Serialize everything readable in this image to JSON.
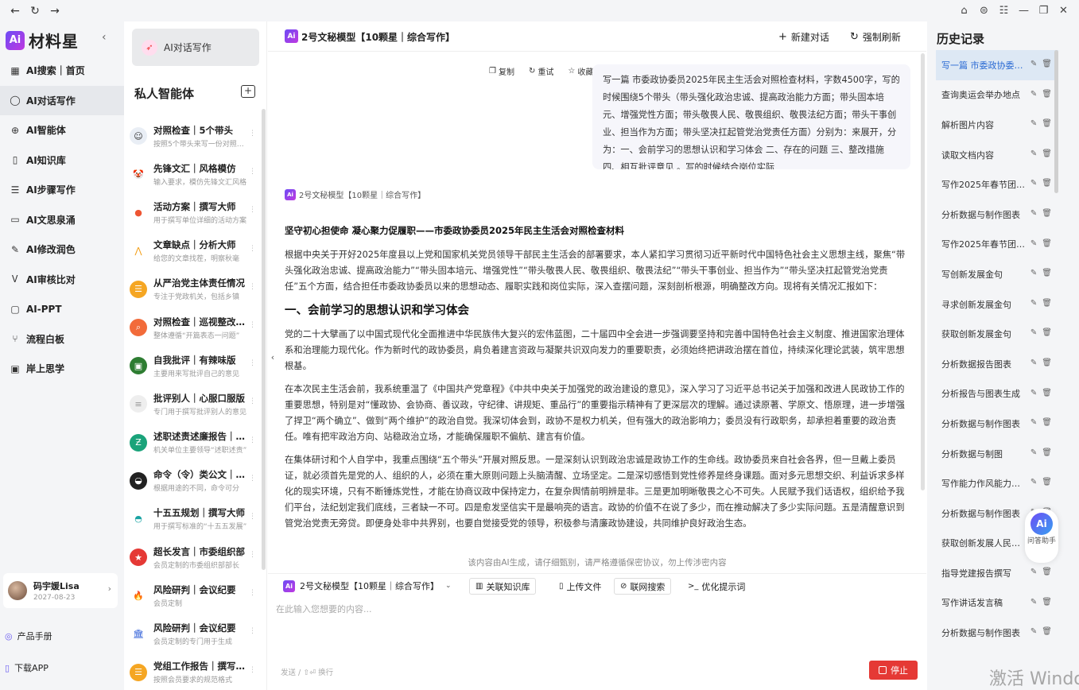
{
  "brand": {
    "logo_mark": "Ai",
    "name": "材料星"
  },
  "nav": {
    "items": [
      {
        "label": "AI搜索｜首页",
        "icon": "grid-icon",
        "glyph": "▦"
      },
      {
        "label": "AI对话写作",
        "icon": "chat-bubble-icon",
        "glyph": "◯",
        "active": true
      },
      {
        "label": "AI智能体",
        "icon": "agent-icon",
        "glyph": "⊕"
      },
      {
        "label": "AI知识库",
        "icon": "book-icon",
        "glyph": "▯"
      },
      {
        "label": "AI步骤写作",
        "icon": "steps-icon",
        "glyph": "☰"
      },
      {
        "label": "AI文思泉涌",
        "icon": "keyboard-icon",
        "glyph": "▭"
      },
      {
        "label": "AI修改润色",
        "icon": "pen-icon",
        "glyph": "✎"
      },
      {
        "label": "AI审核比对",
        "icon": "check-icon",
        "glyph": "Ꮩ"
      },
      {
        "label": "AI-PPT",
        "icon": "ppt-icon",
        "glyph": "▢"
      },
      {
        "label": "流程白板",
        "icon": "flow-icon",
        "glyph": "⑂"
      },
      {
        "label": "岸上思学",
        "icon": "monitor-icon",
        "glyph": "▣"
      }
    ]
  },
  "user": {
    "name": "码宇媛Lisa",
    "date": "2027-08-23"
  },
  "bottom_links": {
    "manual": "产品手册",
    "download": "下载APP"
  },
  "agents_panel": {
    "primary_button": "AI对话写作",
    "title": "私人智能体",
    "items": [
      {
        "name": "对照检查｜5个带头",
        "desc": "按照5个带头来写一份对照检查",
        "color": "#e9eef5",
        "glyph": "☺",
        "fg": "#333"
      },
      {
        "name": "先锋文汇｜风格模仿",
        "desc": "输入要求，模仿先锋文汇风格",
        "color": "#ffffff",
        "glyph": "🤡",
        "fg": "#e33"
      },
      {
        "name": "活动方案｜撰写大师",
        "desc": "用于撰写单位详细的活动方案",
        "color": "#ffffff",
        "glyph": "●",
        "fg": "#e53"
      },
      {
        "name": "文章缺点｜分析大师",
        "desc": "给您的文章找茬，明察秋毫",
        "color": "#ffffff",
        "glyph": "⋀",
        "fg": "#f39c12"
      },
      {
        "name": "从严治党主体责任情况",
        "desc": "专注于党政机关，包括乡镇",
        "color": "#f5a623",
        "glyph": "☰",
        "fg": "#fff"
      },
      {
        "name": "对照检查｜巡视整改专题",
        "desc": "整体遵循“开篇表态一问题”",
        "color": "#f26b3a",
        "glyph": "⌕",
        "fg": "#fff"
      },
      {
        "name": "自我批评｜有辣味版",
        "desc": "主要用来写批评自己的意见",
        "color": "#2e7d32",
        "glyph": "▣",
        "fg": "#fff"
      },
      {
        "name": "批评别人｜心服口服版",
        "desc": "专门用于撰写批评别人的意见",
        "color": "#eeeeee",
        "glyph": "≡",
        "fg": "#999"
      },
      {
        "name": "述职述责述廉报告｜常规",
        "desc": "机关单位主要领导“述职述责”",
        "color": "#1aa37a",
        "glyph": "Ƶ",
        "fg": "#fff"
      },
      {
        "name": "命令（令）类公文｜专业",
        "desc": "根据用途的不同，命令可分",
        "color": "#222222",
        "glyph": "◒",
        "fg": "#fff"
      },
      {
        "name": "十五五规划｜撰写大师",
        "desc": "用于撰写标准的“十五五发展”",
        "color": "#ffffff",
        "glyph": "◓",
        "fg": "#1aa3a3"
      },
      {
        "name": "超长发言｜市委组织部",
        "desc": "会员定制的市委组织部部长",
        "color": "#e53935",
        "glyph": "★",
        "fg": "#fff"
      },
      {
        "name": "风险研判｜会议纪要",
        "desc": "会员定制",
        "color": "#ffffff",
        "glyph": "🔥",
        "fg": "#f39c12"
      },
      {
        "name": "风险研判｜会议纪要",
        "desc": "会员定制的专门用于生成",
        "color": "#ffffff",
        "glyph": "🏛",
        "fg": "#2a5bd7"
      },
      {
        "name": "党组工作报告｜撰写大师",
        "desc": "按照会员要求的规范格式",
        "color": "#f5a623",
        "glyph": "☰",
        "fg": "#fff"
      }
    ]
  },
  "main": {
    "header_title": "2号文秘模型【10颗星｜综合写作】",
    "new_chat": "新建对话",
    "force_refresh": "强制刷新",
    "msg_actions": {
      "copy": "复制",
      "retry": "重试",
      "favorite": "收藏"
    },
    "user_message": "写一篇 市委政协委员2025年民主生活会对照检查材料，字数4500字，写的时候围绕5个带头（带头强化政治忠诚、提高政治能力方面；带头固本培元、增强党性方面；带头敬畏人民、敬畏组织、敬畏法纪方面；带头干事创业、担当作为方面；带头坚决扛起管党治党责任方面）分别为：来展开，分为：一、会前学习的思想认识和学习体会 二、存在的问题 三、整改措施 四、相互批评意见 。写的时候结合岗位实际",
    "bot_label": "2号文秘模型【10颗星｜综合写作】",
    "answer": {
      "title": "坚守初心担使命 凝心聚力促履职——市委政协委员2025年民主生活会对照检查材料",
      "intro": "根据中央关于开好2025年度县以上党和国家机关党员领导干部民主生活会的部署要求，本人紧扣学习贯彻习近平新时代中国特色社会主义思想主线，聚焦“带头强化政治忠诚、提高政治能力”“带头固本培元、增强党性”“带头敬畏人民、敬畏组织、敬畏法纪”“带头干事创业、担当作为”“带头坚决扛起管党治党责任”五个方面，结合担任市委政协委员以来的思想动态、履职实践和岗位实际，深入查摆问题，深刻剖析根源，明确整改方向。现将有关情况汇报如下：",
      "h1": "一、会前学习的思想认识和学习体会",
      "p1": "党的二十大擘画了以中国式现代化全面推进中华民族伟大复兴的宏伟蓝图，二十届四中全会进一步强调要坚持和完善中国特色社会主义制度、推进国家治理体系和治理能力现代化。作为新时代的政协委员，肩负着建言资政与凝聚共识双向发力的重要职责，必须始终把讲政治摆在首位，持续深化理论武装，筑牢思想根基。",
      "p2": "在本次民主生活会前，我系统重温了《中国共产党章程》《中共中央关于加强党的政治建设的意见》，深入学习了习近平总书记关于加强和改进人民政协工作的重要思想，特别是对“懂政协、会协商、善议政，守纪律、讲规矩、重品行”的重要指示精神有了更深层次的理解。通过读原著、学原文、悟原理，进一步增强了捍卫“两个确立”、做到“两个维护”的政治自觉。我深切体会到，政协不是权力机关，但有强大的政治影响力；委员没有行政职务，却承担着重要的政治责任。唯有把牢政治方向、站稳政治立场，才能确保履职不偏航、建言有价值。",
      "p3": "在集体研讨和个人自学中，我重点围绕“五个带头”开展对照反思。一是深刻认识到政治忠诚是政协工作的生命线。政协委员来自社会各界，但一旦戴上委员证，就必须首先是党的人、组织的人，必须在重大原则问题上头脑清醒、立场坚定。二是深切感悟到党性修养是终身课题。面对多元思想交织、利益诉求多样化的现实环境，只有不断锤炼党性，才能在协商议政中保持定力，在复杂舆情前明辨是非。三是更加明晰敬畏之心不可失。人民赋予我们话语权，组织给予我们平台，法纪划定我们底线，三者缺一不可。四是愈发坚信实干是最响亮的语言。政协的价值不在说了多少，而在推动解决了多少实际问题。五是清醒意识到管党治党责无旁贷。即便身处非中共界别，也要自觉接受党的领导，积极参与清廉政协建设，共同维护良好政治生态。"
    },
    "disclaimer": "该内容由AI生成，请仔细甄别，请严格遵循保密协议，勿上传涉密内容",
    "composer": {
      "model": "2号文秘模型【10颗星｜综合写作】",
      "kb": "关联知识库",
      "upload": "上传文件",
      "web": "联网搜索",
      "prompt": "优化提示词",
      "placeholder": "在此输入您想要的内容...",
      "hint": "发送 / ⇧⏎ 换行",
      "stop": "停止"
    }
  },
  "history": {
    "title": "历史记录",
    "items": [
      {
        "label": "写一篇 市委政协委员2025年民主生活会",
        "active": true
      },
      {
        "label": "查询奥运会举办地点"
      },
      {
        "label": "解析图片内容"
      },
      {
        "label": "读取文档内容"
      },
      {
        "label": "写作2025年春节团拜会讲话稿"
      },
      {
        "label": "分析数据与制作图表"
      },
      {
        "label": "写作2025年春节团拜会致辞"
      },
      {
        "label": "写创新发展金句"
      },
      {
        "label": "寻求创新发展金句"
      },
      {
        "label": "获取创新发展金句"
      },
      {
        "label": "分析数据报告图表"
      },
      {
        "label": "分析报告与图表生成"
      },
      {
        "label": "分析数据与制作图表"
      },
      {
        "label": "分析数据与制图"
      },
      {
        "label": "写作能力作风能力提升"
      },
      {
        "label": "分析数据与制作图表"
      },
      {
        "label": "获取创新发展人民金句"
      },
      {
        "label": "指导党建报告撰写"
      },
      {
        "label": "写作讲话发言稿"
      },
      {
        "label": "分析数据与制作图表"
      }
    ]
  },
  "assistant": {
    "badge": "Ai",
    "label": "问答助手"
  },
  "watermark": "激活 Windows"
}
